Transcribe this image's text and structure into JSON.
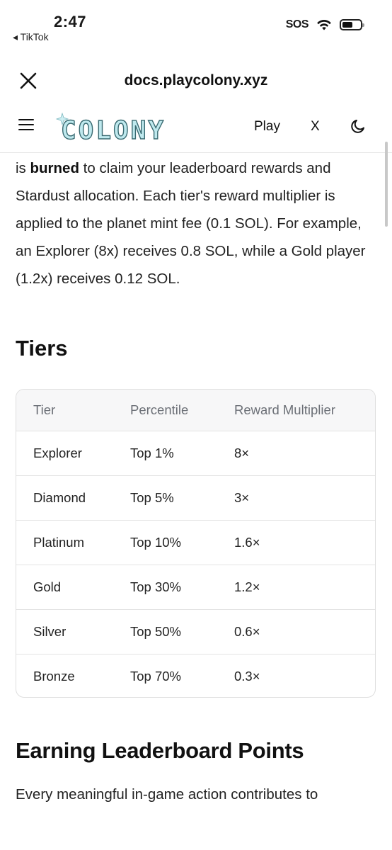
{
  "status_bar": {
    "time": "2:47",
    "back_app": "◂ TikTok",
    "sos": "SOS",
    "icons": [
      "wifi-icon",
      "battery-icon"
    ]
  },
  "browser": {
    "url": "docs.playcolony.xyz",
    "close_icon": "close-icon"
  },
  "site_nav": {
    "menu_icon": "hamburger-icon",
    "logo_text": "COLONY",
    "links": [
      "Play",
      "X"
    ],
    "theme_icon": "moon-icon"
  },
  "content": {
    "intro": {
      "lead": "is ",
      "bold": "burned",
      "rest": " to claim your leaderboard rewards and Stardust allocation. Each tier's reward multiplier is applied to the planet mint fee (0.1 SOL). For example, an Explorer (8x) receives 0.8 SOL, while a Gold player (1.2x) receives 0.12 SOL."
    },
    "tiers_heading": "Tiers",
    "table": {
      "headers": [
        "Tier",
        "Percentile",
        "Reward Multiplier"
      ],
      "rows": [
        [
          "Explorer",
          "Top 1%",
          "8×"
        ],
        [
          "Diamond",
          "Top 5%",
          "3×"
        ],
        [
          "Platinum",
          "Top 10%",
          "1.6×"
        ],
        [
          "Gold",
          "Top 30%",
          "1.2×"
        ],
        [
          "Silver",
          "Top 50%",
          "0.6×"
        ],
        [
          "Bronze",
          "Top 70%",
          "0.3×"
        ]
      ]
    },
    "earning_heading": "Earning Leaderboard Points",
    "earning_intro": "Every meaningful in-game action contributes to"
  },
  "colors": {
    "logo_fill": "#bfe9ee",
    "logo_stroke": "#3a6b72",
    "header_text": "#6b6f76",
    "table_header_bg": "#f7f7f8"
  }
}
